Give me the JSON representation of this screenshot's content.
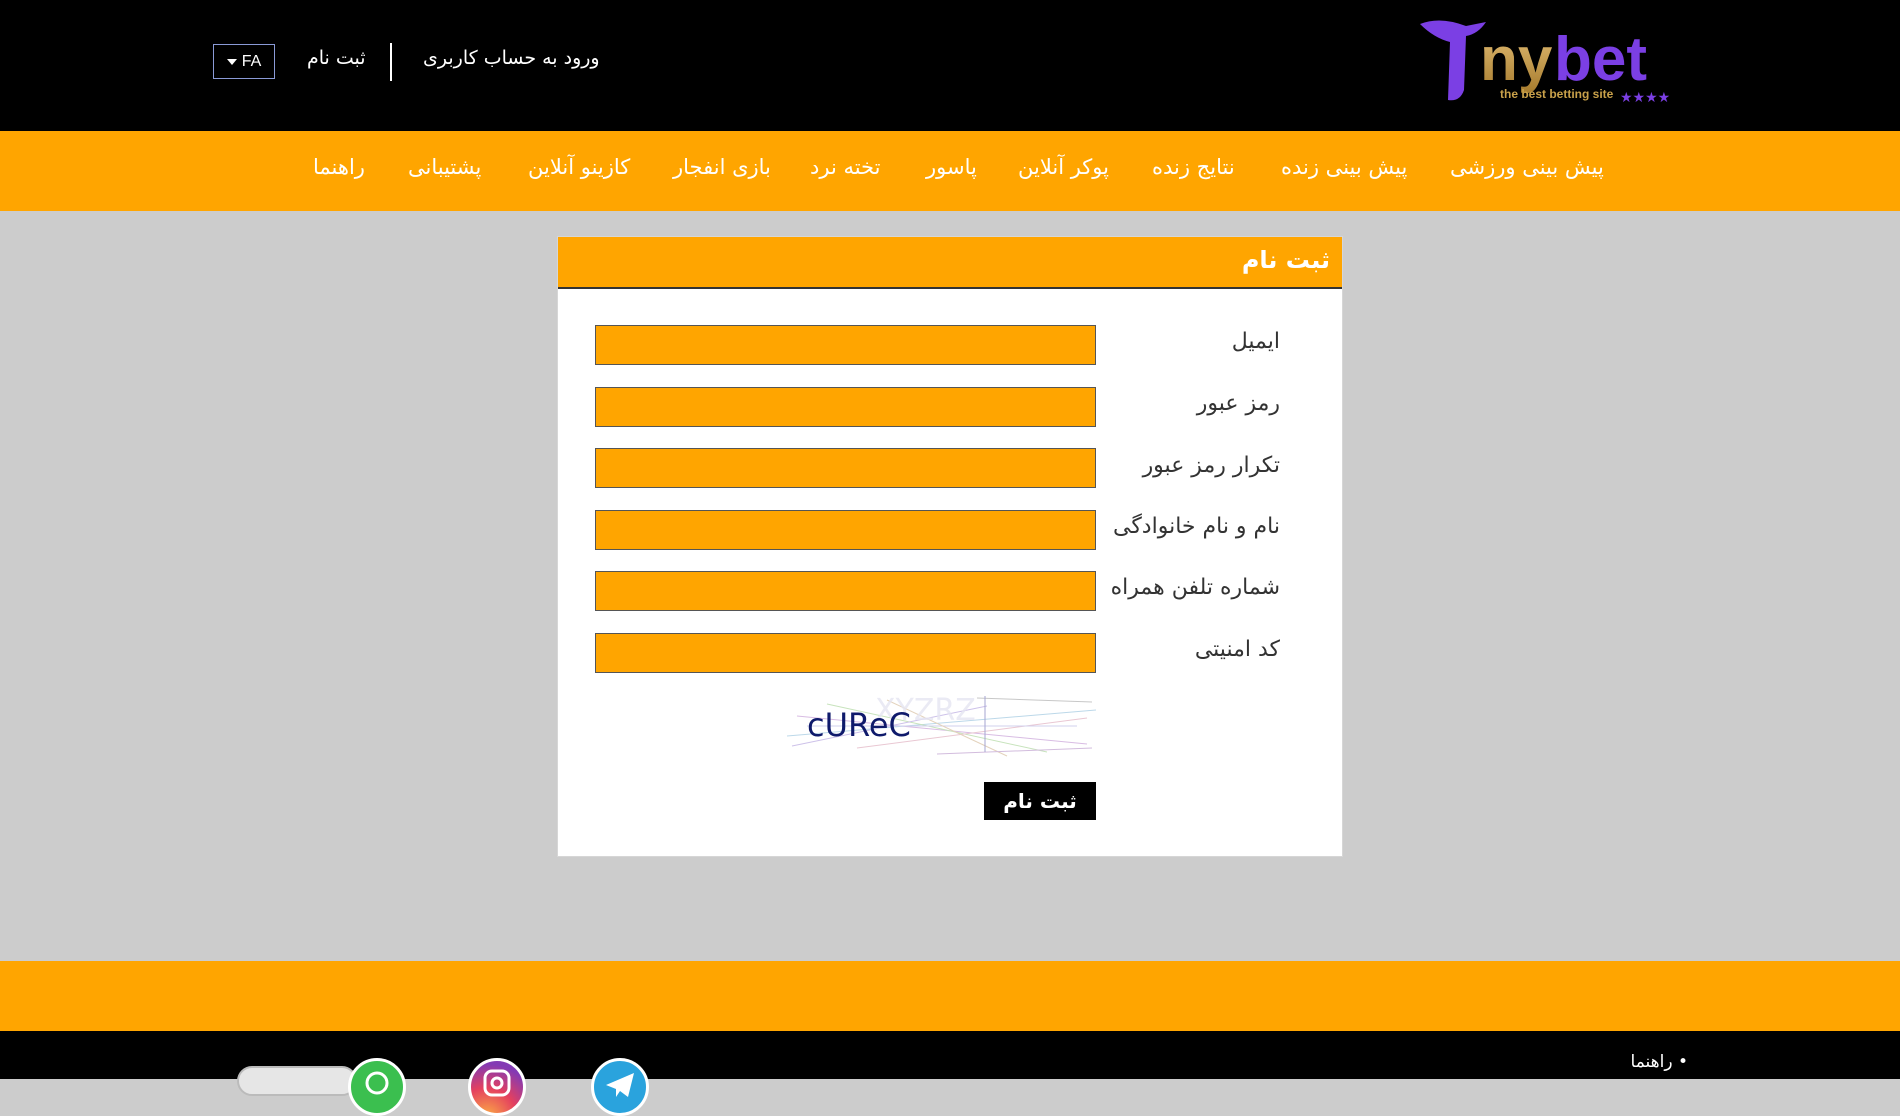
{
  "header": {
    "logo_text": "Tinybet",
    "logo_tagline": "the best betting site",
    "login_link": "ورود به حساب کاربری",
    "register_link": "ثبت نام",
    "language": "FA"
  },
  "nav": {
    "items": [
      {
        "label": "پیش بینی ورزشی"
      },
      {
        "label": "پیش بینی زنده"
      },
      {
        "label": "نتایج زنده"
      },
      {
        "label": "پوکر آنلاین"
      },
      {
        "label": "پاسور"
      },
      {
        "label": "تخته نرد"
      },
      {
        "label": "بازی انفجار"
      },
      {
        "label": "کازینو آنلاین"
      },
      {
        "label": "پشتیبانی"
      },
      {
        "label": "راهنما"
      }
    ]
  },
  "form": {
    "title": "ثبت نام",
    "fields": [
      {
        "label": "ایمیل",
        "value": ""
      },
      {
        "label": "رمز عبور",
        "value": ""
      },
      {
        "label": "تکرار رمز عبور",
        "value": ""
      },
      {
        "label": "نام و نام خانوادگی",
        "value": ""
      },
      {
        "label": "شماره تلفن همراه",
        "value": ""
      },
      {
        "label": "کد امنیتی",
        "value": ""
      }
    ],
    "captcha_text": "cUReC",
    "submit_label": "ثبت نام"
  },
  "footer": {
    "guide_link": "• راهنما"
  },
  "colors": {
    "accent": "#ffa500",
    "header_bg": "#000000",
    "page_bg": "#cccccc",
    "logo_purple": "#7b3fe4",
    "logo_gold": "#c9a14a"
  }
}
